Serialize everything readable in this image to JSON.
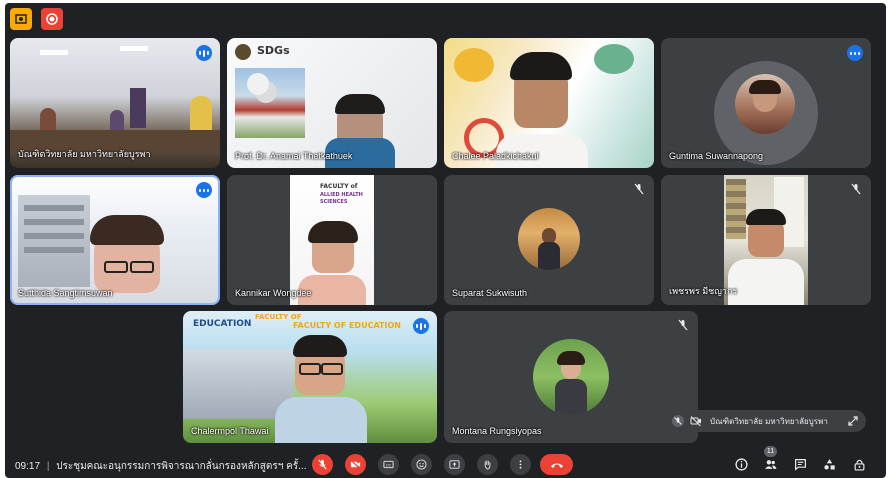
{
  "meeting": {
    "time": "09:17",
    "title": "ประชุมคณะอนุกรรมการพิจารณากลั่นกรองหลักสูตรฯ ครั้...",
    "participant_count": "11"
  },
  "participants": [
    {
      "name": "บัณฑิตวิทยาลัย มหาวิทยาลัยบูรพา",
      "status": "speaking"
    },
    {
      "name": "Prof. Dr. Anamai Thetkathuek",
      "status": "normal"
    },
    {
      "name": "Chalee Paladkichakul",
      "status": "normal"
    },
    {
      "name": "Guntima Suwannapong",
      "status": "speaking"
    },
    {
      "name": "Sutthida Sangtimsuwan",
      "status": "speaking"
    },
    {
      "name": "Kannikar Wongdee",
      "status": "normal"
    },
    {
      "name": "Suparat Sukwisuth",
      "status": "muted"
    },
    {
      "name": "เพชรพร มีชญากร",
      "status": "muted"
    },
    {
      "name": "Chalermpol Thawai",
      "status": "speaking"
    },
    {
      "name": "Montana Rungsiyopas",
      "status": "muted"
    }
  ],
  "slide_texts": {
    "sdgs": "SDGs",
    "ahs_line1": "FACULTY of",
    "ahs_line2": "ALLIED HEALTH",
    "ahs_line3": "SCIENCES",
    "edu_top": "FACULTY OF",
    "edu_line1": "EDUCATION",
    "edu_line2": "FACULTY OF EDUCATION"
  },
  "self_view": {
    "label": "บัณฑิตวิทยาลัย มหาวิทยาลัยบูรพา"
  },
  "colors": {
    "background": "#202124",
    "tile": "#3c4043",
    "accent_blue": "#1a73e8",
    "end_call_red": "#ea4335",
    "record_yellow": "#f9ab00"
  },
  "icons": [
    "recording-icon",
    "record-circle-icon",
    "mic-off-icon",
    "camera-off-icon",
    "captions-icon",
    "emoji-icon",
    "present-icon",
    "hand-icon",
    "more-icon",
    "end-call-icon",
    "info-icon",
    "people-icon",
    "chat-icon",
    "activities-icon",
    "host-controls-icon",
    "expand-icon"
  ]
}
